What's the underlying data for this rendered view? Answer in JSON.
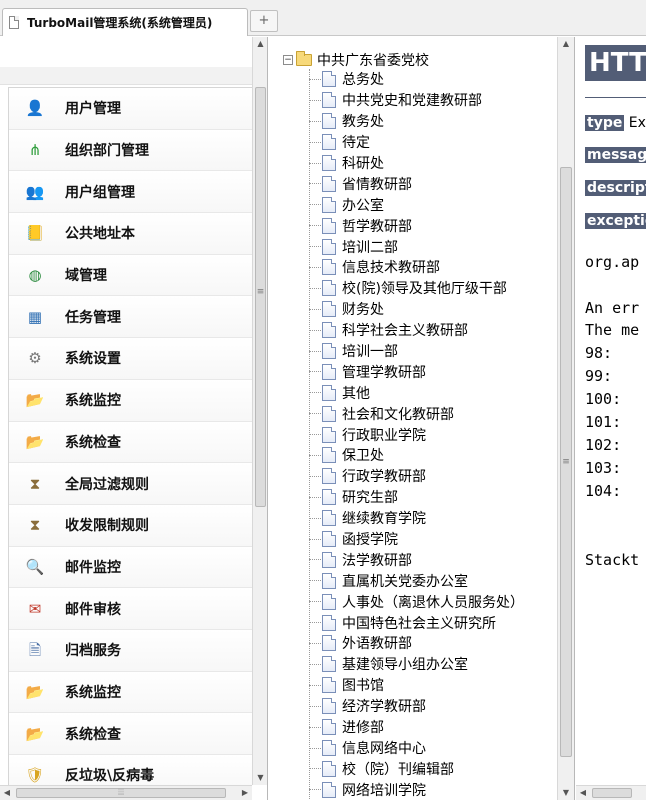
{
  "tab": {
    "title": "TurboMail管理系统(系统管理员)",
    "new_tab": "+"
  },
  "sidebar": {
    "items": [
      {
        "label": "用户管理",
        "icon": "user-icon",
        "glyph": "👤",
        "color": "#c0392b"
      },
      {
        "label": "组织部门管理",
        "icon": "org-tree-icon",
        "glyph": "⋔",
        "color": "#2e9d3a"
      },
      {
        "label": "用户组管理",
        "icon": "user-group-icon",
        "glyph": "👥",
        "color": "#d68a1c"
      },
      {
        "label": "公共地址本",
        "icon": "address-book-icon",
        "glyph": "📒",
        "color": "#8b5a2b"
      },
      {
        "label": "域管理",
        "icon": "globe-icon",
        "glyph": "◍",
        "color": "#2b8a3e"
      },
      {
        "label": "任务管理",
        "icon": "calendar-icon",
        "glyph": "▦",
        "color": "#2f6fb3"
      },
      {
        "label": "系统设置",
        "icon": "gear-icon",
        "glyph": "⚙",
        "color": "#777777"
      },
      {
        "label": "系统监控",
        "icon": "folder-monitor-icon",
        "glyph": "📂",
        "color": "#d9a520"
      },
      {
        "label": "系统检查",
        "icon": "folder-check-icon",
        "glyph": "📂",
        "color": "#d9a520"
      },
      {
        "label": "全局过滤规则",
        "icon": "hourglass-icon",
        "glyph": "⧗",
        "color": "#8a6d3b"
      },
      {
        "label": "收发限制规则",
        "icon": "hourglass-limit-icon",
        "glyph": "⧗",
        "color": "#8a6d3b"
      },
      {
        "label": "邮件监控",
        "icon": "mail-search-icon",
        "glyph": "🔍",
        "color": "#4a6fa5"
      },
      {
        "label": "邮件审核",
        "icon": "mail-review-icon",
        "glyph": "✉",
        "color": "#c0392b"
      },
      {
        "label": "归档服务",
        "icon": "archive-icon",
        "glyph": "🗎",
        "color": "#4a6fa5"
      },
      {
        "label": "系统监控",
        "icon": "folder-monitor-icon",
        "glyph": "📂",
        "color": "#d9a520"
      },
      {
        "label": "系统检查",
        "icon": "folder-check-icon",
        "glyph": "📂",
        "color": "#d9a520"
      },
      {
        "label": "反垃圾\\反病毒",
        "icon": "shield-icon",
        "glyph": "🛡",
        "color": "#d9a520"
      }
    ]
  },
  "tree": {
    "root": "中共广东省委党校",
    "expander": "−",
    "nodes": [
      "总务处",
      "中共党史和党建教研部",
      "教务处",
      "待定",
      "科研处",
      "省情教研部",
      "办公室",
      "哲学教研部",
      "培训二部",
      "信息技术教研部",
      "校(院)领导及其他厅级干部",
      "财务处",
      "科学社会主义教研部",
      "培训一部",
      "管理学教研部",
      "其他",
      "社会和文化教研部",
      "行政职业学院",
      "保卫处",
      "行政学教研部",
      "研究生部",
      "继续教育学院",
      "函授学院",
      "法学教研部",
      "直属机关党委办公室",
      "人事处（离退休人员服务处）",
      "中国特色社会主义研究所",
      "外语教研部",
      "基建领导小组办公室",
      "图书馆",
      "经济学教研部",
      "进修部",
      "信息网络中心",
      "校（院）刊编辑部",
      "网络培训学院"
    ]
  },
  "error_page": {
    "title": "HTTP",
    "type_label": "type",
    "type_value": "Exc",
    "message_label": "message",
    "description_label": "descript",
    "exception_label": "exception",
    "exception_class": "org.ap",
    "lines": [
      "An err",
      "The me",
      "98:",
      "99:",
      "100:",
      "101:",
      "102:",
      "103:",
      "104:"
    ],
    "stacktrace": "Stackt"
  }
}
